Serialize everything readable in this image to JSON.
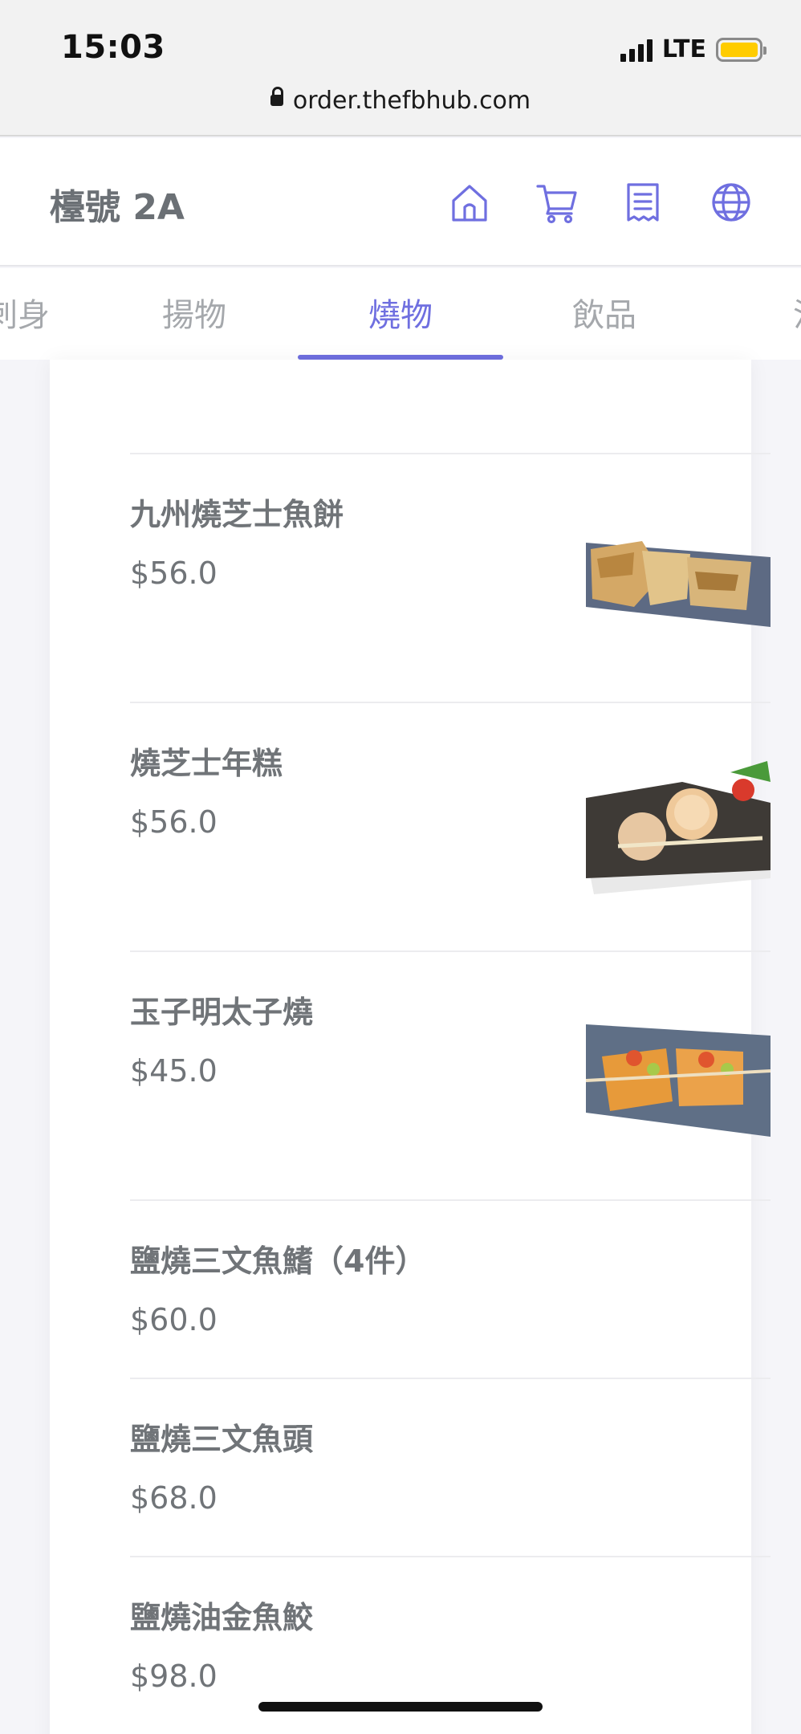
{
  "status_bar": {
    "time": "15:03",
    "network": "LTE"
  },
  "url_bar": {
    "url": "order.thefbhub.com"
  },
  "header": {
    "table_label": "檯號 2A",
    "icons": [
      "home-icon",
      "cart-icon",
      "receipt-icon",
      "globe-icon"
    ]
  },
  "tabs": [
    {
      "label": "刺身",
      "active": false
    },
    {
      "label": "揚物",
      "active": false
    },
    {
      "label": "燒物",
      "active": true
    },
    {
      "label": "飲品",
      "active": false
    },
    {
      "label": "汁",
      "active": false
    }
  ],
  "menu_items": [
    {
      "name": "九州燒芝士魚餅",
      "price": "$56.0",
      "image": "cheese-fishcake"
    },
    {
      "name": "燒芝士年糕",
      "price": "$56.0",
      "image": "cheese-ricecake"
    },
    {
      "name": "玉子明太子燒",
      "price": "$45.0",
      "image": "tamago-mentaiko"
    },
    {
      "name": "鹽燒三文魚鰭（4件）",
      "price": "$60.0"
    },
    {
      "name": "鹽燒三文魚頭",
      "price": "$68.0"
    },
    {
      "name": "鹽燒油金魚鮫",
      "price": "$98.0"
    }
  ],
  "colors": {
    "accent": "#6f6fe0",
    "text": "#707478",
    "tab_inactive": "#a5a8ac"
  }
}
